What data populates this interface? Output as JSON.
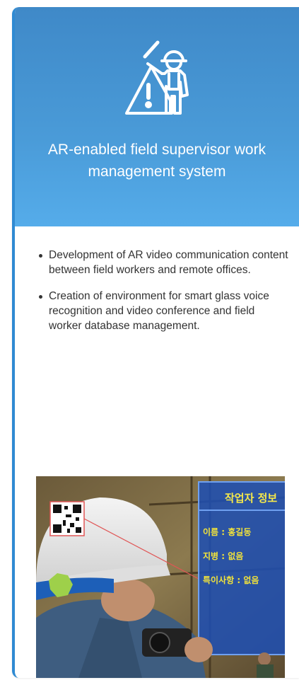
{
  "card": {
    "icon": "worker-warning-icon",
    "title": "AR-enabled field supervisor work management system",
    "bullets": [
      "Development of AR video communication content between field workers and remote offices.",
      "Creation of environment for smart glass voice recognition and video conference and field worker database management."
    ]
  },
  "photo": {
    "ar_panel_title": "작업자 정보",
    "ar_fields": [
      "이름 : 홍길동",
      "지병 : 없음",
      "특이사항 : 없음"
    ],
    "colors": {
      "header_top": "#3f89c8",
      "header_bottom": "#55acea",
      "ar_panel": "#1f4fb0",
      "ar_text": "#f2e33a"
    }
  }
}
